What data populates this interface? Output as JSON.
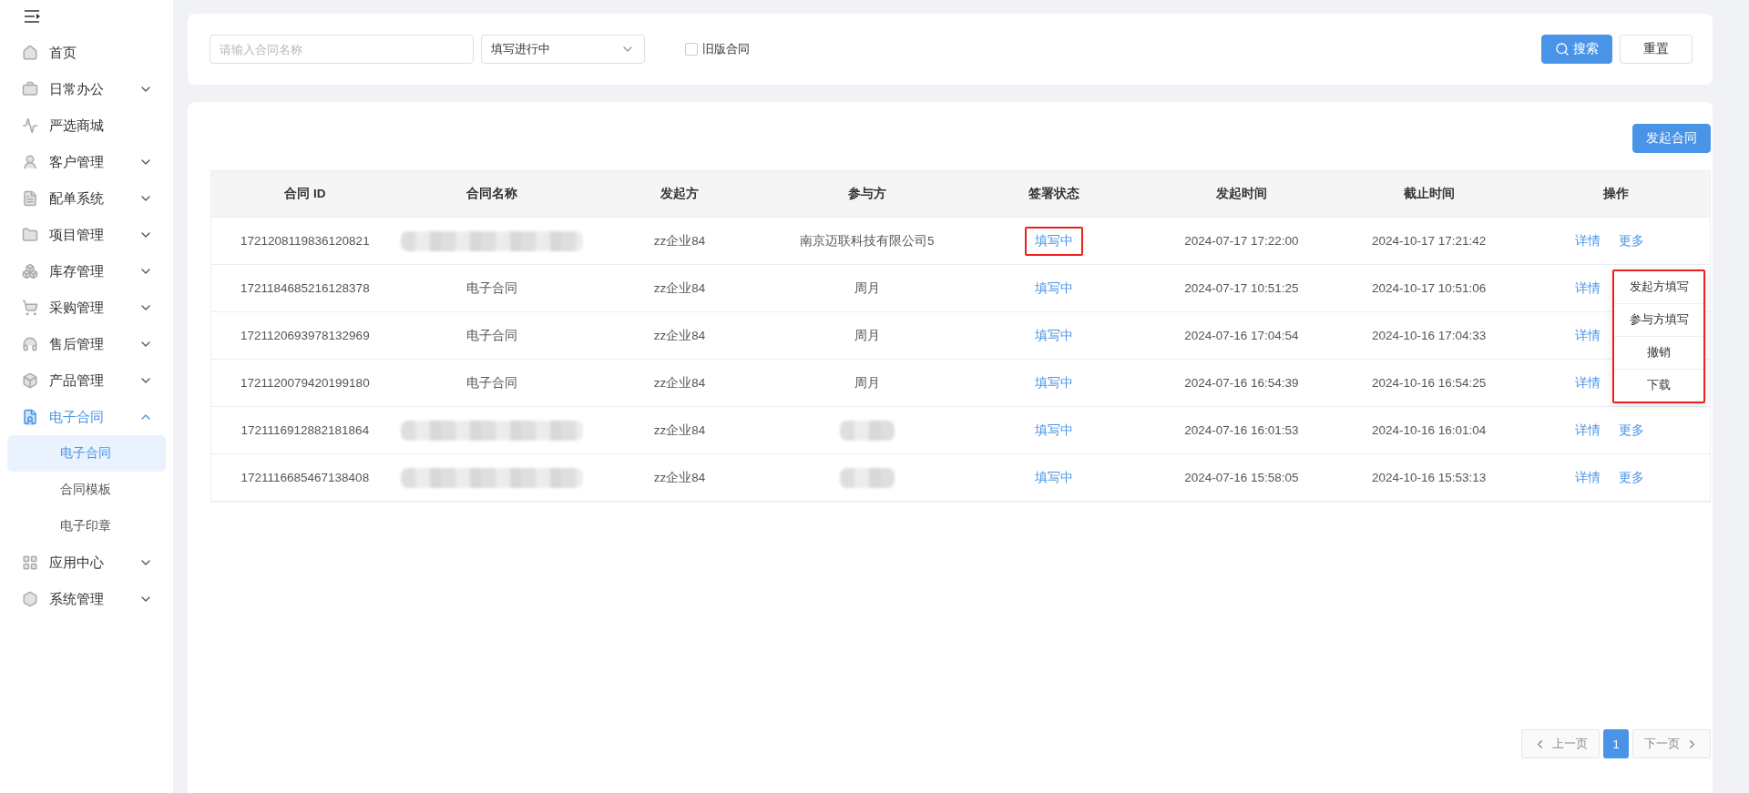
{
  "sidebar": {
    "items": [
      {
        "label": "首页",
        "selected": false
      },
      {
        "label": "日常办公",
        "expanded": false,
        "selected": false
      },
      {
        "label": "严选商城",
        "selected": false
      },
      {
        "label": "客户管理",
        "expanded": false,
        "selected": false
      },
      {
        "label": "配单系统",
        "expanded": false,
        "selected": false
      },
      {
        "label": "项目管理",
        "expanded": false,
        "selected": false
      },
      {
        "label": "库存管理",
        "expanded": false,
        "selected": false
      },
      {
        "label": "采购管理",
        "expanded": false,
        "selected": false
      },
      {
        "label": "售后管理",
        "expanded": false,
        "selected": false
      },
      {
        "label": "产品管理",
        "expanded": false,
        "selected": false
      },
      {
        "label": "电子合同",
        "expanded": true,
        "selected": true,
        "children": [
          {
            "label": "电子合同",
            "selected": true
          },
          {
            "label": "合同模板",
            "selected": false
          },
          {
            "label": "电子印章",
            "selected": false
          }
        ]
      },
      {
        "label": "应用中心",
        "expanded": false,
        "selected": false
      },
      {
        "label": "系统管理",
        "expanded": false,
        "selected": false
      }
    ]
  },
  "filters": {
    "name": {
      "placeholder": "请输入合同名称"
    },
    "status": {
      "value": "填写进行中"
    },
    "old_version": {
      "label": "旧版合同",
      "checked": false
    },
    "search_button": "搜索",
    "reset_button": "重置"
  },
  "create_button": "发起合同",
  "table": {
    "columns": [
      "合同 ID",
      "合同名称",
      "发起方",
      "参与方",
      "签署状态",
      "发起时间",
      "截止时间",
      "操作"
    ],
    "rows": [
      {
        "id": "1721208119836120821",
        "name": {
          "kind": "redacted"
        },
        "initiator": "zz企业84",
        "participant": {
          "kind": "text",
          "text": "南京迈联科技有限公司5"
        },
        "status": "填写中",
        "status_highlighted": true,
        "start": "2024-07-17 17:22:00",
        "end": "2024-10-17 17:21:42",
        "actions": [
          "详情",
          "更多"
        ]
      },
      {
        "id": "1721184685216128378",
        "name": {
          "kind": "text",
          "text": "电子合同"
        },
        "initiator": "zz企业84",
        "participant": {
          "kind": "text",
          "text": "周月"
        },
        "status": "填写中",
        "status_highlighted": false,
        "start": "2024-07-17 10:51:25",
        "end": "2024-10-17 10:51:06",
        "actions": [
          "详情"
        ]
      },
      {
        "id": "1721120693978132969",
        "name": {
          "kind": "text",
          "text": "电子合同"
        },
        "initiator": "zz企业84",
        "participant": {
          "kind": "text",
          "text": "周月"
        },
        "status": "填写中",
        "status_highlighted": false,
        "start": "2024-07-16 17:04:54",
        "end": "2024-10-16 17:04:33",
        "actions": [
          "详情"
        ]
      },
      {
        "id": "1721120079420199180",
        "name": {
          "kind": "text",
          "text": "电子合同"
        },
        "initiator": "zz企业84",
        "participant": {
          "kind": "text",
          "text": "周月"
        },
        "status": "填写中",
        "status_highlighted": false,
        "start": "2024-07-16 16:54:39",
        "end": "2024-10-16 16:54:25",
        "actions": [
          "详情"
        ]
      },
      {
        "id": "1721116912882181864",
        "name": {
          "kind": "redacted"
        },
        "initiator": "zz企业84",
        "participant": {
          "kind": "redacted"
        },
        "status": "填写中",
        "status_highlighted": false,
        "start": "2024-07-16 16:01:53",
        "end": "2024-10-16 16:01:04",
        "actions": [
          "详情",
          "更多"
        ]
      },
      {
        "id": "1721116685467138408",
        "name": {
          "kind": "redacted"
        },
        "initiator": "zz企业84",
        "participant": {
          "kind": "redacted"
        },
        "status": "填写中",
        "status_highlighted": false,
        "start": "2024-07-16 15:58:05",
        "end": "2024-10-16 15:53:13",
        "actions": [
          "详情",
          "更多"
        ]
      }
    ]
  },
  "more_menu": {
    "highlighted": true,
    "items": [
      "发起方填写",
      "参与方填写",
      "撤销",
      "下载"
    ]
  },
  "pagination": {
    "prev": "上一页",
    "pages": [
      {
        "label": "1",
        "selected": true
      }
    ],
    "next": "下一页",
    "prev_disabled": true,
    "next_disabled": true
  }
}
